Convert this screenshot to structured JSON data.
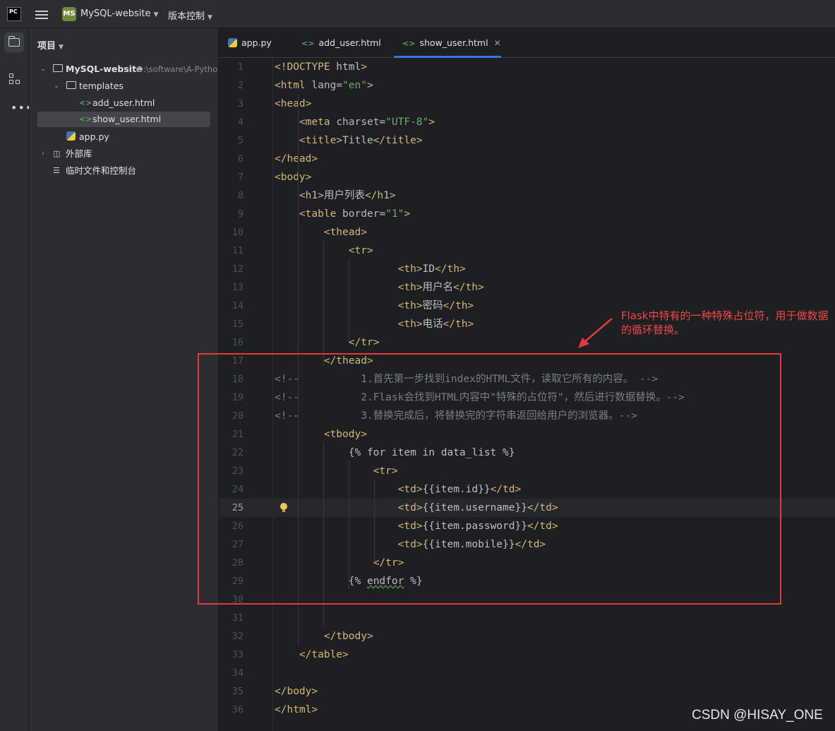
{
  "titlebar": {
    "logo_top": "PC",
    "project_badge": "MS",
    "project_name": "MySQL-website",
    "vcs_label": "版本控制"
  },
  "sidebar": {
    "header": "项目",
    "tree": [
      {
        "label": "MySQL-website",
        "path": "D:\\software\\A-Pytho"
      },
      {
        "label": "templates"
      },
      {
        "label": "add_user.html"
      },
      {
        "label": "show_user.html"
      },
      {
        "label": "app.py"
      },
      {
        "label": "外部库"
      },
      {
        "label": "临时文件和控制台"
      }
    ]
  },
  "tabs": [
    {
      "label": "app.py",
      "icon": "python-file-icon"
    },
    {
      "label": "add_user.html",
      "icon": "html-file-icon"
    },
    {
      "label": "show_user.html",
      "icon": "html-file-icon",
      "active": true
    }
  ],
  "code": {
    "line_numbers": [
      "1",
      "2",
      "3",
      "4",
      "5",
      "6",
      "7",
      "8",
      "9",
      "10",
      "11",
      "12",
      "13",
      "14",
      "15",
      "16",
      "17",
      "18",
      "19",
      "20",
      "21",
      "22",
      "23",
      "24",
      "25",
      "26",
      "27",
      "28",
      "29",
      "30",
      "31",
      "32",
      "33",
      "34",
      "35",
      "36"
    ],
    "current_line": 25,
    "lines": [
      "<!DOCTYPE html>",
      "<html lang=\"en\">",
      "<head>",
      "    <meta charset=\"UTF-8\">",
      "    <title>Title</title>",
      "</head>",
      "<body>",
      "    <h1>用户列表</h1>",
      "    <table border=\"1\">",
      "        <thead>",
      "            <tr>",
      "                    <th>ID</th>",
      "                    <th>用户名</th>",
      "                    <th>密码</th>",
      "                    <th>电话</th>",
      "            </tr>",
      "        </thead>",
      "<!--          1.首先第一步找到index的HTML文件，读取它所有的内容。 -->",
      "<!--          2.Flask会找到HTML内容中\"特殊的占位符\"，然后进行数据替换。-->",
      "<!--          3.替换完成后，将替换完的字符串返回给用户的浏览器。-->",
      "        <tbody>",
      "            {% for item in data_list %}",
      "                <tr>",
      "                    <td>{{item.id}}</td>",
      "                    <td>{{item.username}}</td>",
      "                    <td>{{item.password}}</td>",
      "                    <td>{{item.mobile}}</td>",
      "                </tr>",
      "            {% endfor %}",
      "",
      "",
      "        </tbody>",
      "    </table>",
      "",
      "</body>",
      "</html>"
    ]
  },
  "annotation": {
    "text": "Flask中特有的一种特殊占位符，用于做数据的循环替换。",
    "color": "#f04747"
  },
  "watermark": "CSDN @HISAY_ONE"
}
